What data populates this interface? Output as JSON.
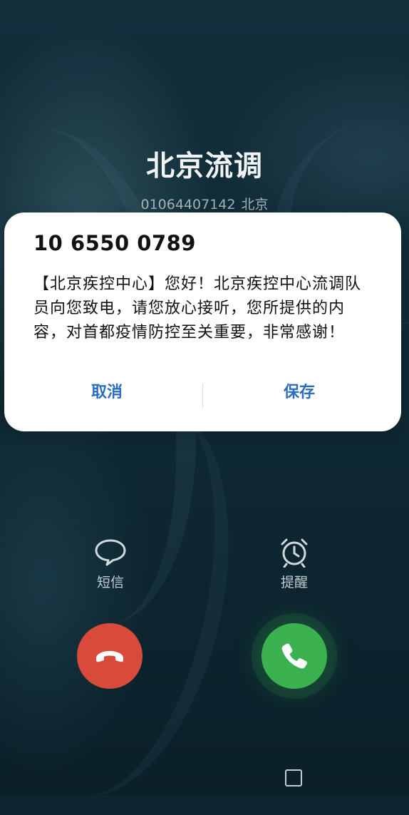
{
  "caller": {
    "name": "北京流调",
    "number": "01064407142",
    "location": "北京"
  },
  "dialog": {
    "sender": "10 6550 0789",
    "message": "【北京疾控中心】您好！北京疾控中心流调队员向您致电，请您放心接听，您所提供的内容，对首都疫情防控至关重要，非常感谢！",
    "cancel_label": "取消",
    "save_label": "保存",
    "action_color": "#2a6ec0"
  },
  "quick_actions": {
    "sms_label": "短信",
    "sms_icon": "message-bubble-icon",
    "remind_label": "提醒",
    "remind_icon": "alarm-clock-icon"
  },
  "call_buttons": {
    "decline_icon": "hang-up-icon",
    "decline_color": "#d84b3b",
    "accept_icon": "phone-icon",
    "accept_color": "#3bb24f"
  },
  "navigation": {
    "recents_icon": "square-icon"
  }
}
